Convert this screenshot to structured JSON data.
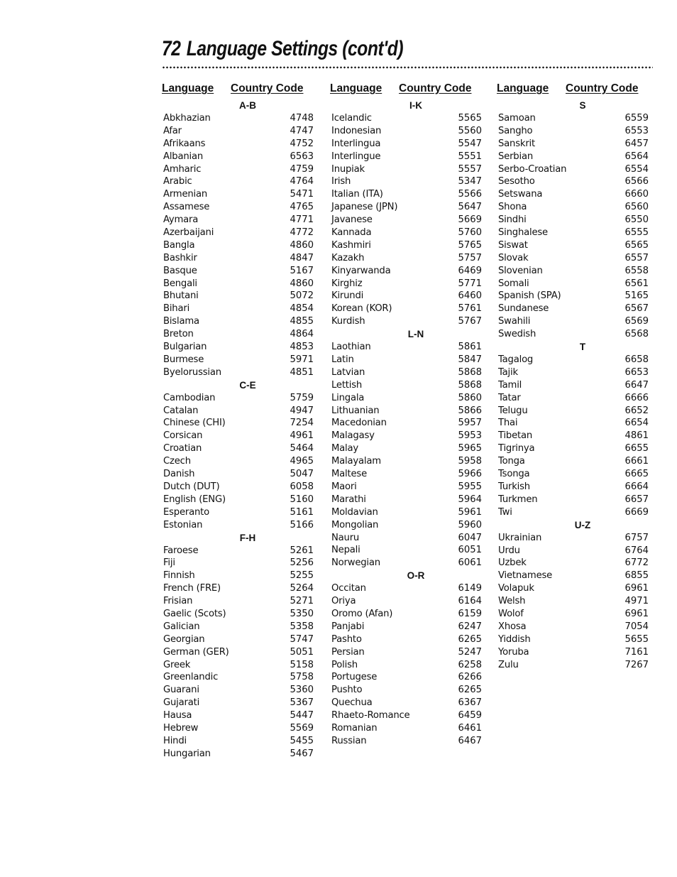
{
  "page": {
    "number": "72",
    "title": "Language Settings (cont'd)"
  },
  "headers": {
    "language": "Language",
    "country_code": "Country Code"
  },
  "columns": [
    {
      "groups": [
        {
          "label": "A-B",
          "entries": [
            {
              "language": "Abkhazian",
              "code": "4748"
            },
            {
              "language": "Afar",
              "code": "4747"
            },
            {
              "language": "Afrikaans",
              "code": "4752"
            },
            {
              "language": "Albanian",
              "code": "6563"
            },
            {
              "language": "Amharic",
              "code": "4759"
            },
            {
              "language": "Arabic",
              "code": "4764"
            },
            {
              "language": "Armenian",
              "code": "5471"
            },
            {
              "language": "Assamese",
              "code": "4765"
            },
            {
              "language": "Aymara",
              "code": "4771"
            },
            {
              "language": "Azerbaijani",
              "code": "4772"
            },
            {
              "language": "Bangla",
              "code": "4860"
            },
            {
              "language": "Bashkir",
              "code": "4847"
            },
            {
              "language": "Basque",
              "code": "5167"
            },
            {
              "language": "Bengali",
              "code": "4860"
            },
            {
              "language": "Bhutani",
              "code": "5072"
            },
            {
              "language": "Bihari",
              "code": "4854"
            },
            {
              "language": "Bislama",
              "code": "4855"
            },
            {
              "language": "Breton",
              "code": "4864"
            },
            {
              "language": "Bulgarian",
              "code": "4853"
            },
            {
              "language": "Burmese",
              "code": "5971"
            },
            {
              "language": "Byelorussian",
              "code": "4851"
            }
          ]
        },
        {
          "label": "C-E",
          "entries": [
            {
              "language": "Cambodian",
              "code": "5759"
            },
            {
              "language": "Catalan",
              "code": "4947"
            },
            {
              "language": "Chinese (CHI)",
              "code": "7254"
            },
            {
              "language": "Corsican",
              "code": "4961"
            },
            {
              "language": "Croatian",
              "code": "5464"
            },
            {
              "language": "Czech",
              "code": "4965"
            },
            {
              "language": "Danish",
              "code": "5047"
            },
            {
              "language": "Dutch (DUT)",
              "code": "6058"
            },
            {
              "language": "English (ENG)",
              "code": "5160"
            },
            {
              "language": "Esperanto",
              "code": "5161"
            },
            {
              "language": "Estonian",
              "code": "5166"
            }
          ]
        },
        {
          "label": "F-H",
          "entries": [
            {
              "language": "Faroese",
              "code": "5261"
            },
            {
              "language": "Fiji",
              "code": "5256"
            },
            {
              "language": "Finnish",
              "code": "5255"
            },
            {
              "language": "French (FRE)",
              "code": "5264"
            },
            {
              "language": "Frisian",
              "code": "5271"
            },
            {
              "language": "Gaelic (Scots)",
              "code": "5350"
            },
            {
              "language": "Galician",
              "code": "5358"
            },
            {
              "language": "Georgian",
              "code": "5747"
            },
            {
              "language": "German (GER)",
              "code": "5051"
            },
            {
              "language": "Greek",
              "code": "5158"
            },
            {
              "language": "Greenlandic",
              "code": "5758"
            },
            {
              "language": "Guarani",
              "code": "5360"
            },
            {
              "language": "Gujarati",
              "code": "5367"
            },
            {
              "language": "Hausa",
              "code": "5447"
            },
            {
              "language": "Hebrew",
              "code": "5569"
            },
            {
              "language": "Hindi",
              "code": "5455"
            },
            {
              "language": "Hungarian",
              "code": "5467"
            }
          ]
        }
      ]
    },
    {
      "groups": [
        {
          "label": "I-K",
          "entries": [
            {
              "language": "Icelandic",
              "code": "5565"
            },
            {
              "language": "Indonesian",
              "code": "5560"
            },
            {
              "language": "Interlingua",
              "code": "5547"
            },
            {
              "language": "Interlingue",
              "code": "5551"
            },
            {
              "language": "Inupiak",
              "code": "5557"
            },
            {
              "language": "Irish",
              "code": "5347"
            },
            {
              "language": "Italian (ITA)",
              "code": "5566"
            },
            {
              "language": "Japanese (JPN)",
              "code": "5647"
            },
            {
              "language": "Javanese",
              "code": "5669"
            },
            {
              "language": "Kannada",
              "code": "5760"
            },
            {
              "language": "Kashmiri",
              "code": "5765"
            },
            {
              "language": "Kazakh",
              "code": "5757"
            },
            {
              "language": "Kinyarwanda",
              "code": "6469"
            },
            {
              "language": "Kirghiz",
              "code": "5771"
            },
            {
              "language": "Kirundi",
              "code": "6460"
            },
            {
              "language": "Korean (KOR)",
              "code": "5761"
            },
            {
              "language": "Kurdish",
              "code": "5767"
            }
          ]
        },
        {
          "label": "L-N",
          "entries": [
            {
              "language": "Laothian",
              "code": "5861"
            },
            {
              "language": "Latin",
              "code": "5847"
            },
            {
              "language": "Latvian",
              "code": "5868"
            },
            {
              "language": "Lettish",
              "code": "5868"
            },
            {
              "language": "Lingala",
              "code": "5860"
            },
            {
              "language": "Lithuanian",
              "code": "5866"
            },
            {
              "language": "Macedonian",
              "code": "5957"
            },
            {
              "language": "Malagasy",
              "code": "5953"
            },
            {
              "language": "Malay",
              "code": "5965"
            },
            {
              "language": "Malayalam",
              "code": "5958"
            },
            {
              "language": "Maltese",
              "code": "5966"
            },
            {
              "language": "Maori",
              "code": "5955"
            },
            {
              "language": "Marathi",
              "code": "5964"
            },
            {
              "language": "Moldavian",
              "code": "5961"
            },
            {
              "language": "Mongolian",
              "code": "5960"
            },
            {
              "language": "Nauru",
              "code": "6047"
            },
            {
              "language": "Nepali",
              "code": "6051"
            },
            {
              "language": "Norwegian",
              "code": "6061"
            }
          ]
        },
        {
          "label": "O-R",
          "entries": [
            {
              "language": "Occitan",
              "code": "6149"
            },
            {
              "language": "Oriya",
              "code": "6164"
            },
            {
              "language": "Oromo (Afan)",
              "code": "6159"
            },
            {
              "language": "Panjabi",
              "code": "6247"
            },
            {
              "language": "Pashto",
              "code": "6265"
            },
            {
              "language": "Persian",
              "code": "5247"
            },
            {
              "language": "Polish",
              "code": "6258"
            },
            {
              "language": "Portugese",
              "code": "6266"
            },
            {
              "language": "Pushto",
              "code": "6265"
            },
            {
              "language": "Quechua",
              "code": "6367"
            },
            {
              "language": "Rhaeto-Romance",
              "code": "6459"
            },
            {
              "language": "Romanian",
              "code": "6461"
            },
            {
              "language": "Russian",
              "code": "6467"
            }
          ]
        }
      ]
    },
    {
      "groups": [
        {
          "label": "S",
          "entries": [
            {
              "language": "Samoan",
              "code": "6559"
            },
            {
              "language": "Sangho",
              "code": "6553"
            },
            {
              "language": "Sanskrit",
              "code": "6457"
            },
            {
              "language": "Serbian",
              "code": "6564"
            },
            {
              "language": "Serbo-Croatian",
              "code": "6554"
            },
            {
              "language": "Sesotho",
              "code": "6566"
            },
            {
              "language": "Setswana",
              "code": "6660"
            },
            {
              "language": "Shona",
              "code": "6560"
            },
            {
              "language": "Sindhi",
              "code": "6550"
            },
            {
              "language": "Singhalese",
              "code": "6555"
            },
            {
              "language": "Siswat",
              "code": "6565"
            },
            {
              "language": "Slovak",
              "code": "6557"
            },
            {
              "language": "Slovenian",
              "code": "6558"
            },
            {
              "language": "Somali",
              "code": "6561"
            },
            {
              "language": "Spanish (SPA)",
              "code": "5165"
            },
            {
              "language": "Sundanese",
              "code": "6567"
            },
            {
              "language": "Swahili",
              "code": "6569"
            },
            {
              "language": "Swedish",
              "code": "6568"
            }
          ]
        },
        {
          "label": "T",
          "entries": [
            {
              "language": "Tagalog",
              "code": "6658"
            },
            {
              "language": "Tajik",
              "code": "6653"
            },
            {
              "language": "Tamil",
              "code": "6647"
            },
            {
              "language": "Tatar",
              "code": "6666"
            },
            {
              "language": "Telugu",
              "code": "6652"
            },
            {
              "language": "Thai",
              "code": "6654"
            },
            {
              "language": "Tibetan",
              "code": "4861"
            },
            {
              "language": "Tigrinya",
              "code": "6655"
            },
            {
              "language": "Tonga",
              "code": "6661"
            },
            {
              "language": "Tsonga",
              "code": "6665"
            },
            {
              "language": "Turkish",
              "code": "6664"
            },
            {
              "language": "Turkmen",
              "code": "6657"
            },
            {
              "language": "Twi",
              "code": "6669"
            }
          ]
        },
        {
          "label": "U-Z",
          "entries": [
            {
              "language": "Ukrainian",
              "code": "6757"
            },
            {
              "language": "Urdu",
              "code": "6764"
            },
            {
              "language": "Uzbek",
              "code": "6772"
            },
            {
              "language": "Vietnamese",
              "code": "6855"
            },
            {
              "language": "Volapuk",
              "code": "6961"
            },
            {
              "language": "Welsh",
              "code": "4971"
            },
            {
              "language": "Wolof",
              "code": "6961"
            },
            {
              "language": "Xhosa",
              "code": "7054"
            },
            {
              "language": "Yiddish",
              "code": "5655"
            },
            {
              "language": "Yoruba",
              "code": "7161"
            },
            {
              "language": "Zulu",
              "code": "7267"
            }
          ]
        }
      ]
    }
  ]
}
